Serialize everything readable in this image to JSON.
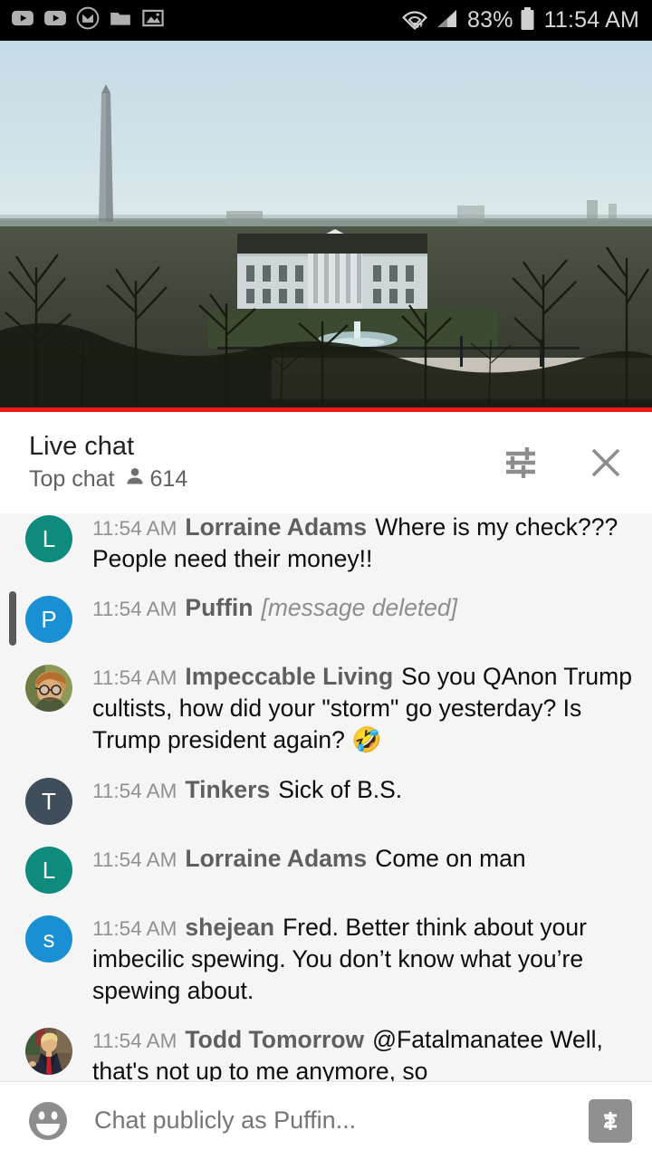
{
  "status_bar": {
    "icons": [
      "youtube-icon",
      "youtube-icon",
      "gmail-m-icon",
      "folder-icon",
      "photo-icon"
    ],
    "wifi_icon": "wifi-icon",
    "signal_icon": "cell-signal-icon",
    "battery_percent": "83%",
    "battery_icon": "battery-icon",
    "clock": "11:54 AM"
  },
  "video": {
    "scene": "White House and Washington Monument live stream",
    "progress_color": "#ec1a12"
  },
  "chat_header": {
    "title": "Live chat",
    "mode": "Top chat",
    "viewer_icon": "person-icon",
    "viewer_count": "614",
    "filter_icon": "filter-sliders-icon",
    "close_icon": "close-icon"
  },
  "messages": [
    {
      "id": "msg-lorraine-1",
      "timestamp": "11:54 AM",
      "author": "Lorraine Adams",
      "text": "Where is my check??? People need their money!!",
      "deleted": false,
      "avatar": {
        "type": "initial",
        "initial": "L",
        "color": "#0f8b7e"
      }
    },
    {
      "id": "msg-puffin-1",
      "timestamp": "11:54 AM",
      "author": "Puffin",
      "text": "[message deleted]",
      "deleted": true,
      "avatar": {
        "type": "initial",
        "initial": "P",
        "color": "#1b8fd4"
      }
    },
    {
      "id": "msg-impeccable-1",
      "timestamp": "11:54 AM",
      "author": "Impeccable Living",
      "text": "So you QAnon Trump cultists, how did your \"storm\" go yesterday? Is Trump president again? ",
      "emoji": "🤣",
      "deleted": false,
      "avatar": {
        "type": "photo",
        "photo": "person-glasses-photo",
        "color": "#7d8a4e"
      }
    },
    {
      "id": "msg-tinkers-1",
      "timestamp": "11:54 AM",
      "author": "Tinkers",
      "text": "Sick of B.S.",
      "deleted": false,
      "avatar": {
        "type": "initial",
        "initial": "T",
        "color": "#3f4e5a"
      }
    },
    {
      "id": "msg-lorraine-2",
      "timestamp": "11:54 AM",
      "author": "Lorraine Adams",
      "text": "Come on man",
      "deleted": false,
      "avatar": {
        "type": "initial",
        "initial": "L",
        "color": "#0f8b7e"
      }
    },
    {
      "id": "msg-shejean-1",
      "timestamp": "11:54 AM",
      "author": "shejean",
      "text": "Fred. Better think about your imbecilic spewing. You don’t know what you’re spewing about.",
      "deleted": false,
      "avatar": {
        "type": "initial",
        "initial": "s",
        "color": "#1b8fd4"
      }
    },
    {
      "id": "msg-todd-1",
      "timestamp": "11:54 AM",
      "author": "Todd Tomorrow",
      "text": "@Fatalmanatee Well, that's not up to me anymore, so",
      "deleted": false,
      "avatar": {
        "type": "photo",
        "photo": "person-suit-redtie-photo",
        "color": "#5a4a3a"
      }
    }
  ],
  "composer": {
    "emoji_icon": "emoji-smiley-icon",
    "placeholder": "Chat publicly as Puffin...",
    "value": "",
    "superchat_icon": "superchat-dollar-icon"
  }
}
